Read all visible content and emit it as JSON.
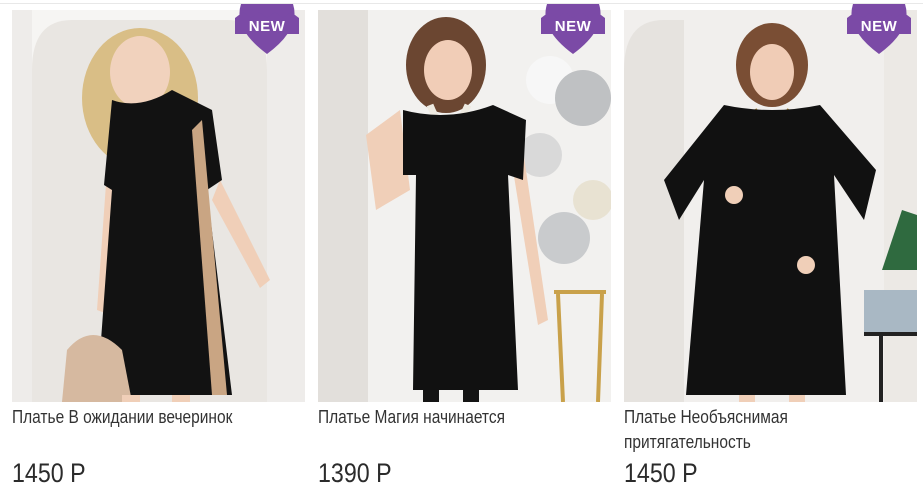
{
  "badge": {
    "label": "NEW",
    "color": "#7b4aa6"
  },
  "products": [
    {
      "title": "Платье В ожидании вечеринок",
      "price": "1450 Р"
    },
    {
      "title": "Платье Магия начинается",
      "price": "1390 Р"
    },
    {
      "title": "Платье Необъяснимая притягательность",
      "price": "1450 Р"
    }
  ]
}
